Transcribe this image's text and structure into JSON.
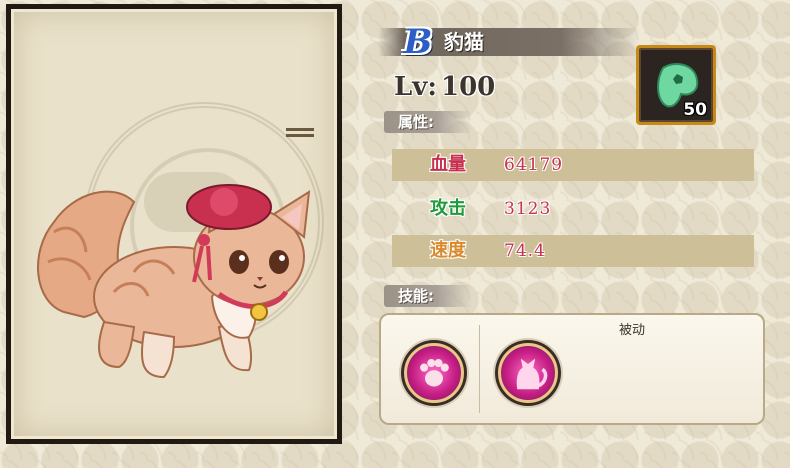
{
  "pet": {
    "grade": "B",
    "name": "豹猫",
    "level_label": "Lv:",
    "level": "100"
  },
  "attributes": {
    "label": "属性:",
    "stats": [
      {
        "name": "血量",
        "value": "64179",
        "color": "#c8304f"
      },
      {
        "name": "攻击",
        "value": "3123",
        "color": "#1e9a3a"
      },
      {
        "name": "速度",
        "value": "74.4",
        "color": "#d8892a"
      }
    ]
  },
  "skills": {
    "label": "技能:",
    "passive_label": "被动",
    "items": [
      {
        "icon": "paw-skill-icon"
      },
      {
        "icon": "cat-silhouette-skill-icon"
      }
    ]
  },
  "item": {
    "icon": "green-jade-fragment-icon",
    "count": "50"
  },
  "colors": {
    "accent_pink": "#c8304f",
    "badge_blue": "#2d5ec8",
    "frame_gold": "#c68a18"
  }
}
